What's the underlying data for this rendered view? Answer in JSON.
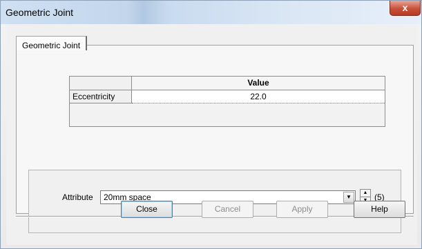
{
  "window": {
    "title": "Geometric Joint",
    "close_glyph": "x"
  },
  "tabs": [
    {
      "label": "Geometric Joint"
    }
  ],
  "grid": {
    "column_header": "Value",
    "rows": [
      {
        "label": "Eccentricity",
        "value": "22.0"
      }
    ]
  },
  "attribute": {
    "label": "Attribute",
    "value": "20mm space",
    "count": "(5)",
    "dropdown_icon": "chevron-down-icon",
    "spinner_icons": [
      "spin-up-icon",
      "spin-down-icon"
    ]
  },
  "buttons": {
    "close": "Close",
    "cancel": "Cancel",
    "apply": "Apply",
    "help": "Help"
  },
  "colors": {
    "close_button": "#c8503a",
    "disabled_text": "#8d8d8d"
  }
}
